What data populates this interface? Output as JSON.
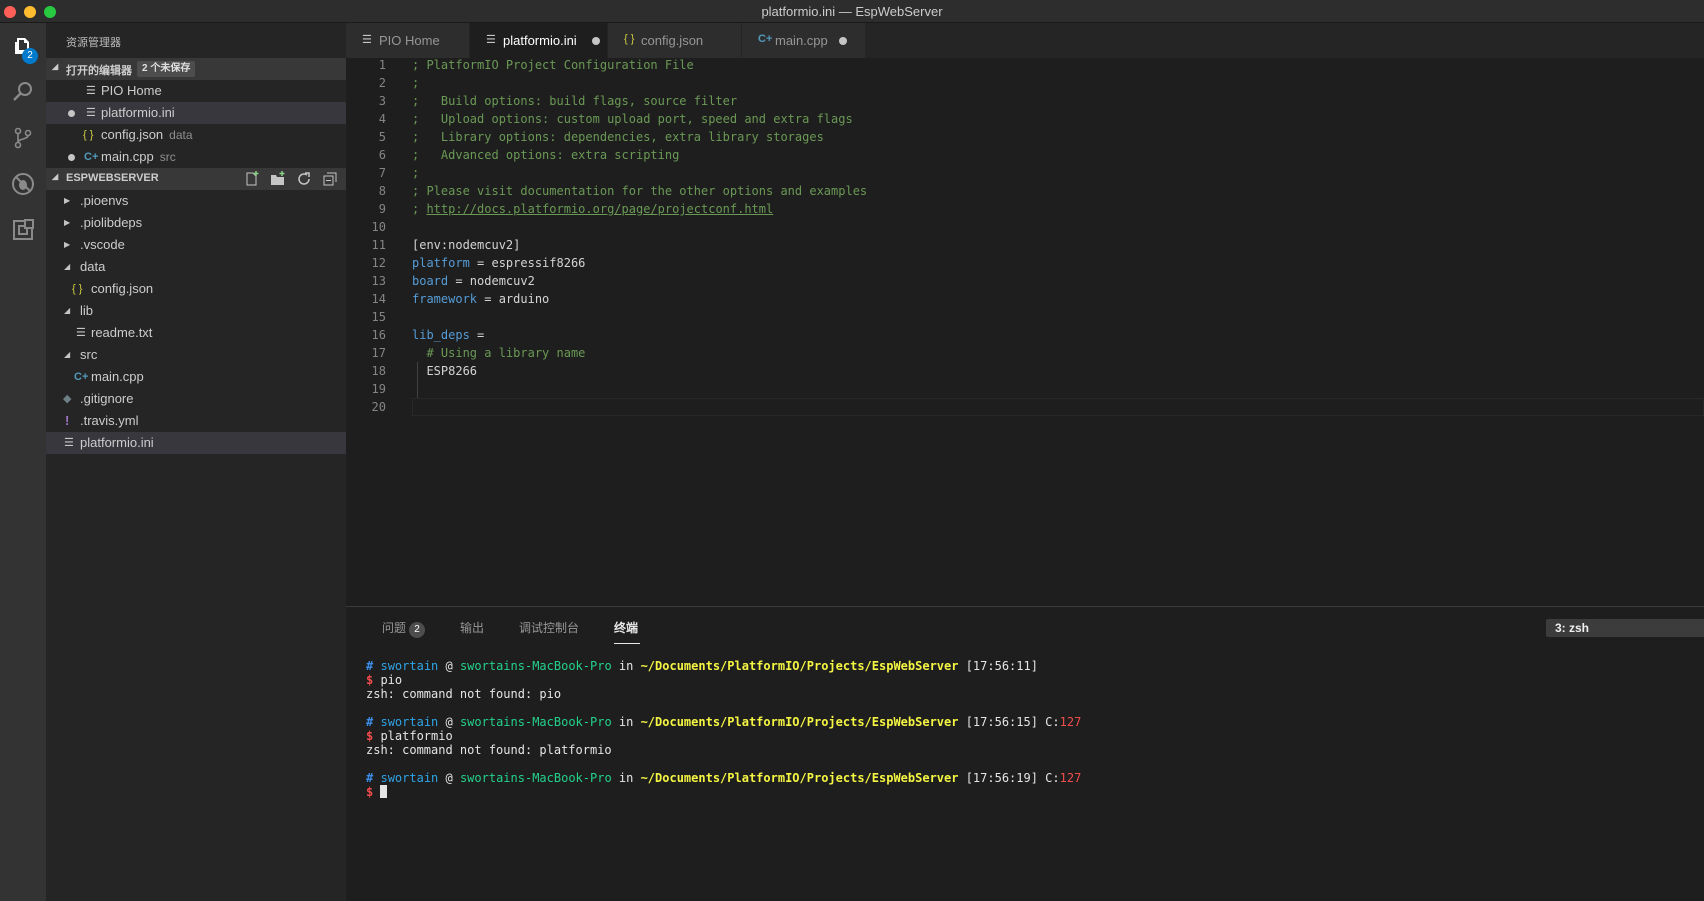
{
  "window": {
    "title": "platformio.ini — EspWebServer"
  },
  "activity_bar": {
    "explorer_badge": "2"
  },
  "sidebar": {
    "title": "资源管理器",
    "open_editors": {
      "header": "打开的编辑器",
      "badge": "2 个未保存",
      "items": [
        {
          "name": "PIO Home",
          "desc": ""
        },
        {
          "name": "platformio.ini",
          "desc": ""
        },
        {
          "name": "config.json",
          "desc": "data"
        },
        {
          "name": "main.cpp",
          "desc": "src"
        }
      ]
    },
    "project": {
      "header": "ESPWEBSERVER",
      "items": [
        {
          "name": ".pioenvs"
        },
        {
          "name": ".piolibdeps"
        },
        {
          "name": ".vscode"
        },
        {
          "name": "data"
        },
        {
          "name": "config.json"
        },
        {
          "name": "lib"
        },
        {
          "name": "readme.txt"
        },
        {
          "name": "src"
        },
        {
          "name": "main.cpp"
        },
        {
          "name": ".gitignore"
        },
        {
          "name": ".travis.yml"
        },
        {
          "name": "platformio.ini"
        }
      ]
    }
  },
  "tabs": [
    {
      "label": "PIO Home"
    },
    {
      "label": "platformio.ini"
    },
    {
      "label": "config.json"
    },
    {
      "label": "main.cpp"
    }
  ],
  "editor": {
    "line_numbers": [
      "1",
      "2",
      "3",
      "4",
      "5",
      "6",
      "7",
      "8",
      "9",
      "10",
      "11",
      "12",
      "13",
      "14",
      "15",
      "16",
      "17",
      "18",
      "19",
      "20"
    ],
    "lines": {
      "l1": "; PlatformIO Project Configuration File",
      "l2": ";",
      "l3": ";   Build options: build flags, source filter",
      "l4": ";   Upload options: custom upload port, speed and extra flags",
      "l5": ";   Library options: dependencies, extra library storages",
      "l6": ";   Advanced options: extra scripting",
      "l7": ";",
      "l8": "; Please visit documentation for the other options and examples",
      "l9_prefix": "; ",
      "l9_url": "http://docs.platformio.org/page/projectconf.html",
      "l11": "[env:nodemcuv2]",
      "l12_key": "platform",
      "l12_val": " = espressif8266",
      "l13_key": "board",
      "l13_val": " = nodemcuv2",
      "l14_key": "framework",
      "l14_val": " = arduino",
      "l16_key": "lib_deps",
      "l16_val": " =",
      "l17": "  # Using a library name",
      "l18": "  ESP8266"
    }
  },
  "panel": {
    "tabs": {
      "problems": "问题",
      "problems_count": "2",
      "output": "输出",
      "debug": "调试控制台",
      "terminal": "终端"
    },
    "terminal_select": "3: zsh",
    "terminal": {
      "hash": "#",
      "user": "swortain",
      "at": " @ ",
      "host": "swortains-MacBook-Pro",
      "in": " in ",
      "path": "~/Documents/PlatformIO/Projects/EspWebServer",
      "time1": " [17:56:11]",
      "time2": " [17:56:15] C:",
      "time3": " [17:56:19] C:",
      "exit_code": "127",
      "dollar": "$",
      "cmd1": " pio",
      "err1": "zsh: command not found: pio",
      "cmd2": " platformio",
      "err2": "zsh: command not found: platformio"
    }
  }
}
